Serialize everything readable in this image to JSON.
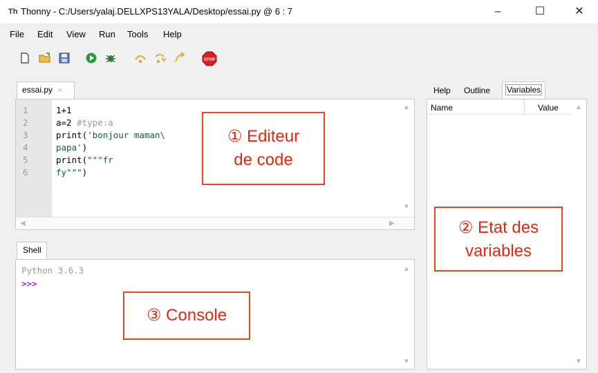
{
  "window": {
    "title": "Thonny  -  C:/Users/yalaj.DELLXPS13YALA/Desktop/essai.py  @  6 : 7",
    "app_icon": "Th",
    "minimize": "–",
    "maximize": "☐",
    "close": "✕"
  },
  "menu": [
    "File",
    "Edit",
    "View",
    "Run",
    "Tools",
    "Help"
  ],
  "toolbar": {
    "icons": [
      "new-file-icon",
      "open-folder-icon",
      "save-icon",
      "run-icon",
      "debug-icon",
      "step-over-icon",
      "step-into-icon",
      "step-out-icon",
      "stop-icon"
    ],
    "stop_label": "STOP"
  },
  "editor": {
    "tab_label": "essai.py",
    "tab_close": "×",
    "lines": [
      {
        "num": "1",
        "parts": [
          {
            "t": "1+1",
            "c": "normal"
          }
        ]
      },
      {
        "num": "2",
        "parts": [
          {
            "t": "a=2 ",
            "c": "normal"
          },
          {
            "t": "#type:a",
            "c": "comment"
          }
        ]
      },
      {
        "num": "3",
        "parts": [
          {
            "t": "print(",
            "c": "normal"
          },
          {
            "t": "'bonjour maman\\",
            "c": "string"
          }
        ]
      },
      {
        "num": "4",
        "parts": [
          {
            "t": "papa'",
            "c": "string"
          },
          {
            "t": ")",
            "c": "normal"
          }
        ]
      },
      {
        "num": "5",
        "parts": [
          {
            "t": "print(",
            "c": "normal"
          },
          {
            "t": "\"\"\"fr",
            "c": "string"
          }
        ]
      },
      {
        "num": "6",
        "parts": [
          {
            "t": "fy\"\"\"",
            "c": "string"
          },
          {
            "t": ")",
            "c": "normal"
          }
        ]
      }
    ]
  },
  "shell": {
    "tab_label": "Shell",
    "version_line": "Python 3.6.3",
    "prompt": ">>>"
  },
  "right_panel": {
    "tabs": [
      "Help",
      "Outline",
      "Variables"
    ],
    "active_tab": "Variables",
    "columns": [
      "Name",
      "Value"
    ]
  },
  "annotations": {
    "editor_line1": "① Editeur",
    "editor_line2": "de code",
    "vars_line1": "② Etat des",
    "vars_line2": "variables",
    "console": "③ Console"
  },
  "colors": {
    "accent_annotation": "#e02a10",
    "string": "#0a6a24",
    "comment": "#999999",
    "prompt": "#8a2be2"
  }
}
